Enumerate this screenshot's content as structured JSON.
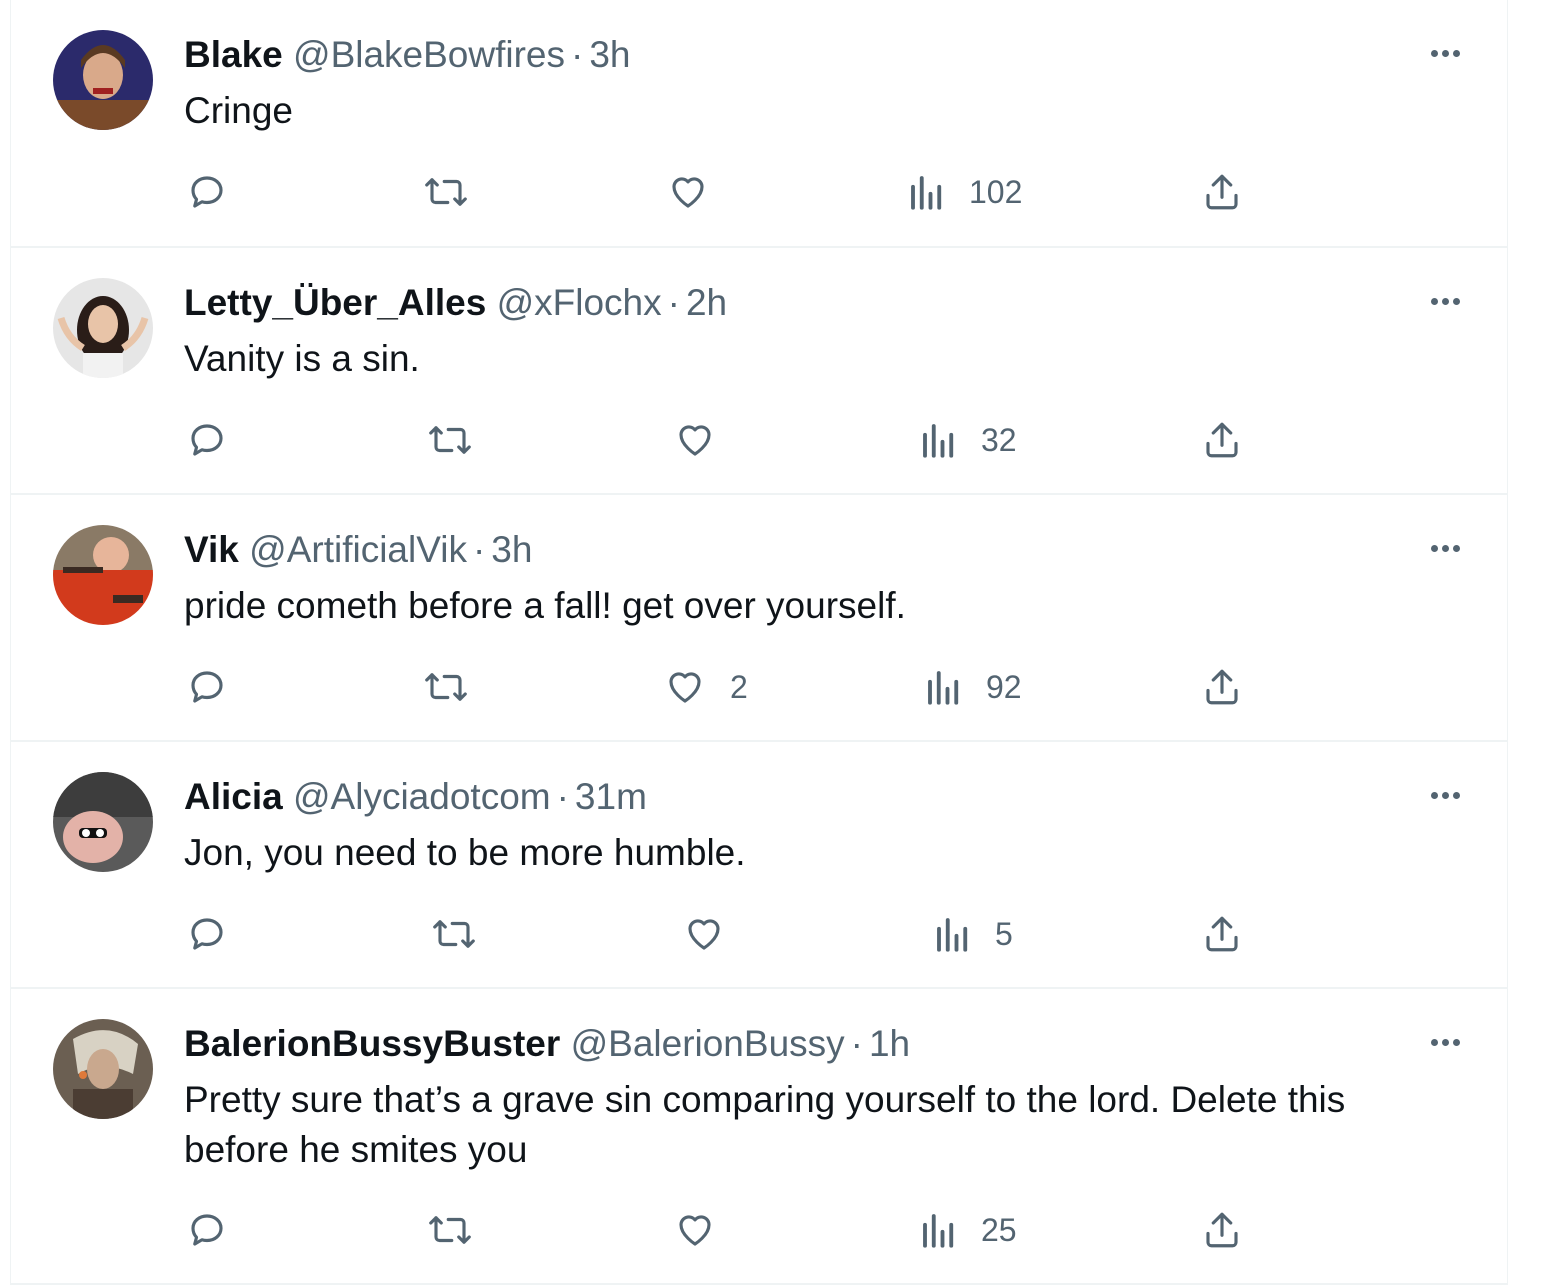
{
  "tweets": [
    {
      "name": "Blake",
      "handle": "@BlakeBowfires",
      "separator": "·",
      "time": "3h",
      "text": "Cringe",
      "likes": "",
      "views": "102",
      "avatar_colors": [
        "#2b2a6b",
        "#7a4a2a"
      ]
    },
    {
      "name": "Letty_Über_Alles",
      "handle": "@xFlochx",
      "separator": "·",
      "time": "2h",
      "text": "Vanity is a sin.",
      "likes": "",
      "views": "32",
      "avatar_colors": [
        "#d9d9d9",
        "#2a1d18"
      ]
    },
    {
      "name": "Vik",
      "handle": "@ArtificialVik",
      "separator": "·",
      "time": "3h",
      "text": "pride cometh before a fall! get over yourself.",
      "likes": "2",
      "views": "92",
      "avatar_colors": [
        "#8a7a66",
        "#d23a1c"
      ]
    },
    {
      "name": "Alicia",
      "handle": "@Alyciadotcom",
      "separator": "·",
      "time": "31m",
      "text": "Jon, you need to be more humble.",
      "likes": "",
      "views": "5",
      "avatar_colors": [
        "#3d3d3d",
        "#e3b2a8"
      ]
    },
    {
      "name": "BalerionBussyBuster",
      "handle": "@BalerionBussy",
      "separator": "·",
      "time": "1h",
      "text": "Pretty sure that’s a grave sin comparing yourself to the lord. Delete this before he smites you",
      "likes": "",
      "views": "25",
      "avatar_colors": [
        "#d8d2c4",
        "#4b3d33"
      ]
    }
  ],
  "icons": {
    "reply": "reply-icon",
    "retweet": "retweet-icon",
    "like": "like-icon",
    "views": "views-icon",
    "share": "share-icon",
    "more": "more-icon"
  },
  "colors": {
    "text": "#0f1419",
    "secondary": "#536471",
    "divider": "#eff3f4"
  }
}
